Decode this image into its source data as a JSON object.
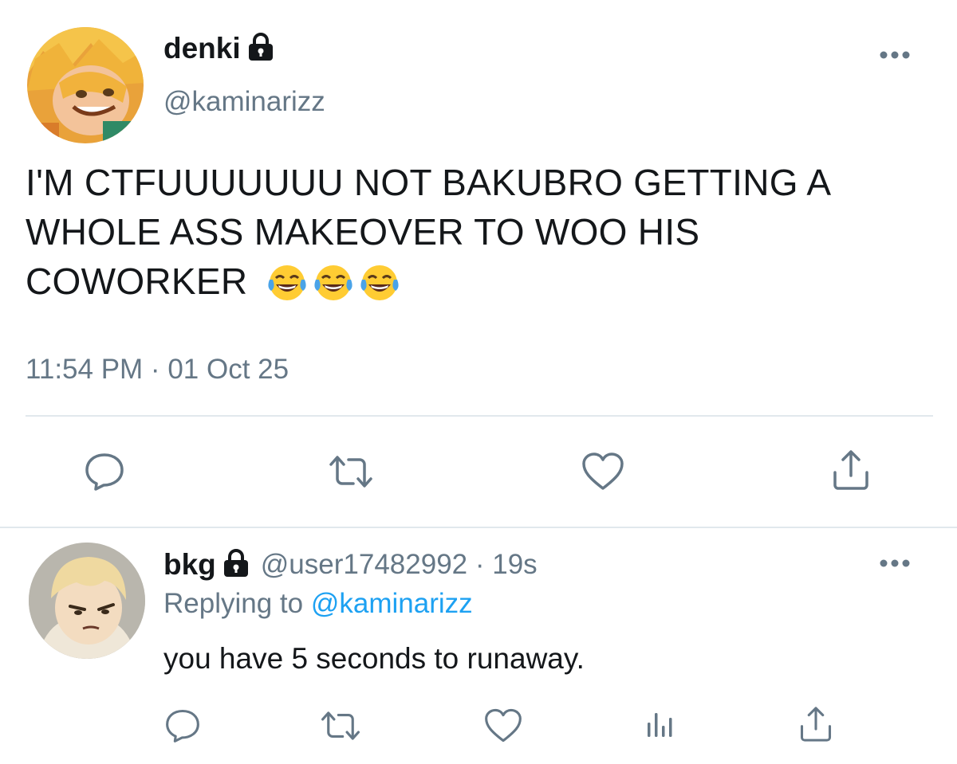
{
  "tweet": {
    "display_name": "denki",
    "handle": "@kaminarizz",
    "text_line1": "I'M CTFUUUUUUU NOT BAKUBRO GETTING A",
    "text_line2": "WHOLE ASS MAKEOVER TO WOO HIS",
    "text_line3": "COWORKER",
    "emojis": [
      "😂",
      "😂",
      "😂"
    ],
    "timestamp": "11:54 PM · 01 Oct 25",
    "actions": [
      "reply-icon",
      "retweet-icon",
      "like-icon",
      "share-icon"
    ]
  },
  "reply": {
    "display_name": "bkg",
    "handle_time": "@user17482992 · 19s",
    "replying_prefix": "Replying to",
    "replying_mention": "@kaminarizz",
    "text": "you have 5 seconds to runaway.",
    "actions": [
      "reply-icon",
      "retweet-icon",
      "like-icon",
      "analytics-icon",
      "share-icon"
    ]
  },
  "colors": {
    "text": "#14171a",
    "secondary": "#657786",
    "link": "#1da1f2",
    "divider": "#e1e8ed"
  }
}
